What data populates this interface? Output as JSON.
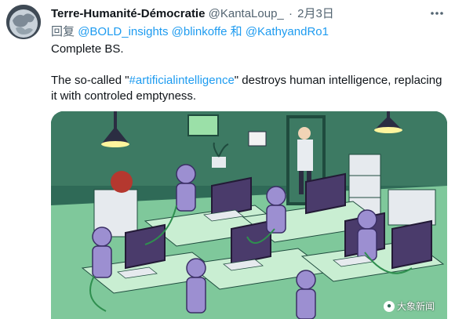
{
  "tweet": {
    "author": {
      "display_name": "Terre-Humanité-Démocratie",
      "handle": "@KantaLoup_",
      "separator": "·",
      "date": "2月3日"
    },
    "reply": {
      "prefix": "回复",
      "mentions": [
        "@BOLD_insights",
        "@blinkoffe",
        "和",
        "@KathyandRo1"
      ]
    },
    "text": {
      "line1": "Complete BS.",
      "line2_before": "The so-called \"",
      "hashtag": "#artificialintelligence",
      "line2_after": "\" destroys human intelligence, replacing it with controled emptyness."
    },
    "media": {
      "watermark": "大象新闻"
    }
  },
  "icons": {
    "more": "more-horizontal-icon",
    "watermark_logo": "elephant-logo-icon"
  },
  "colors": {
    "link": "#1d9bf0",
    "secondary_text": "#536471",
    "primary_text": "#0f1419"
  }
}
